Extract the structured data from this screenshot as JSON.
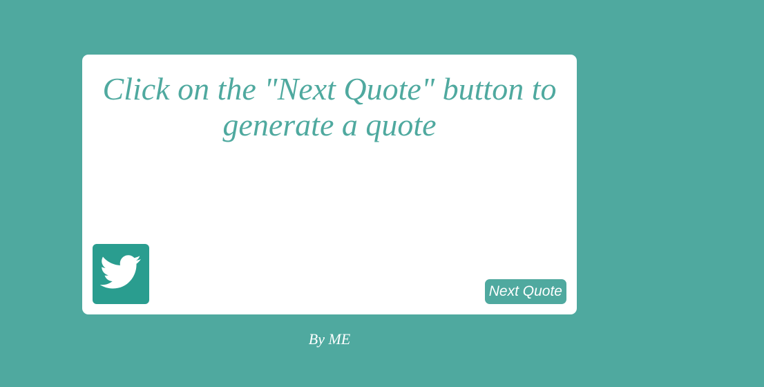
{
  "quote": {
    "text": "Click on the \"Next Quote\" button to generate a quote"
  },
  "actions": {
    "tweet_icon": "twitter-bird-icon",
    "next_label": "Next Quote"
  },
  "footer": {
    "credit": "By ME"
  },
  "colors": {
    "background": "#4fa99f",
    "card": "#ffffff",
    "tweet_button": "#2a9d8f"
  }
}
